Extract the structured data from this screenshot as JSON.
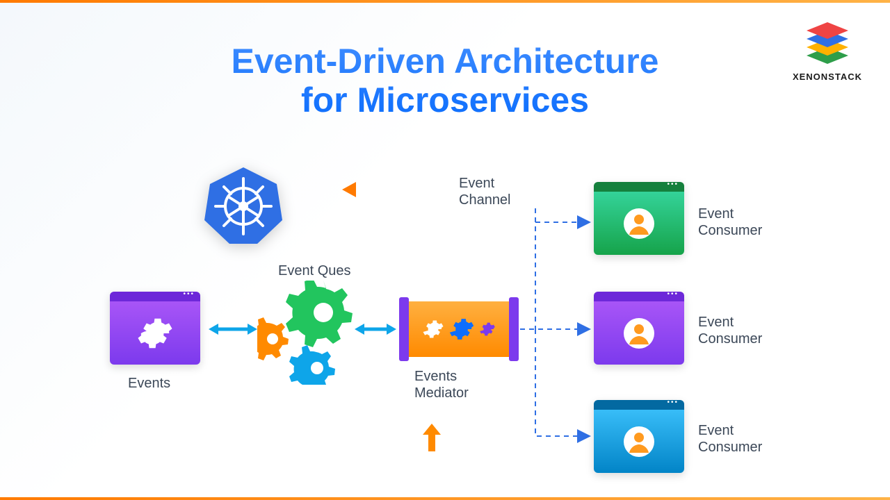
{
  "title_line1": "Event-Driven Architecture",
  "title_line2": "for Microservices",
  "brand": "XENONSTACK",
  "labels": {
    "events": "Events",
    "event_ques": "Event Ques",
    "events_mediator": "Events\nMediator",
    "event_channel": "Event\nChannel",
    "event_consumer": "Event\nConsumer"
  },
  "colors": {
    "purple": "#8b5cf6",
    "green": "#22c55e",
    "blue": "#0ea5e9",
    "orange": "#ff8a00",
    "k8s": "#2f6fe4",
    "dash": "#2f6fe4",
    "text": "#3c4858"
  },
  "consumers": [
    {
      "id": 1,
      "color": "green"
    },
    {
      "id": 2,
      "color": "purple"
    },
    {
      "id": 3,
      "color": "blue"
    }
  ]
}
